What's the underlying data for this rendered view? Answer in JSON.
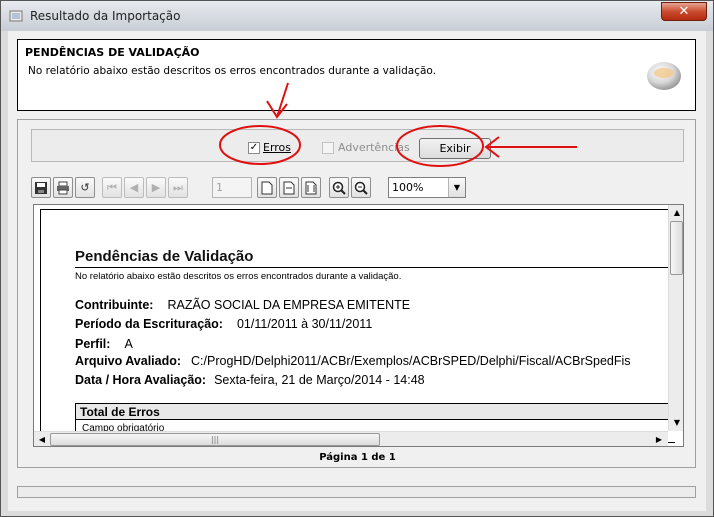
{
  "window": {
    "title": "Resultado da Importação",
    "close_label": "✕"
  },
  "header": {
    "title": "PENDÊNCIAS DE VALIDAÇÃO",
    "description": "No relatório abaixo estão descritos os erros encontrados durante a validação."
  },
  "filters": {
    "erros_label": "Erros",
    "erros_checked": true,
    "advertencias_label": "Advertências",
    "advertencias_checked": false,
    "show_button_label": "Exibir"
  },
  "toolbar": {
    "page_number": "1",
    "zoom": "100%",
    "icons": [
      "save-icon",
      "print-icon",
      "refresh-icon",
      "first-page-icon",
      "prev-page-icon",
      "next-page-icon",
      "last-page-icon",
      "single-page-icon",
      "page-width-icon",
      "full-page-icon",
      "zoom-in-icon",
      "zoom-out-icon"
    ]
  },
  "report": {
    "title": "Pendências de Validação",
    "subtitle": "No relatório abaixo estão descritos os erros encontrados durante a validação.",
    "contribuinte_label": "Contribuinte:",
    "contribuinte_value": "RAZÃO SOCIAL DA EMPRESA EMITENTE",
    "periodo_label": "Período da Escrituração:",
    "periodo_value": "01/11/2011 à 30/11/2011",
    "perfil_label": "Perfil:",
    "perfil_value": "A",
    "arquivo_label": "Arquivo Avaliado:",
    "arquivo_value": "C:/ProgHD/Delphi2011/ACBr/Exemplos/ACBrSPED/Delphi/Fiscal/ACBrSpedFis",
    "data_label": "Data / Hora Avaliação:",
    "data_value": "Sexta-feira, 21 de Março/2014 - 14:48",
    "total_header": "Total de Erros",
    "total_first_item": "Campo obrigatório"
  },
  "pagination": {
    "status": "Página 1 de 1"
  },
  "colors": {
    "annotation": "#e01010",
    "window_bg": "#f0f0f0",
    "close_button": "#c94b2f"
  }
}
